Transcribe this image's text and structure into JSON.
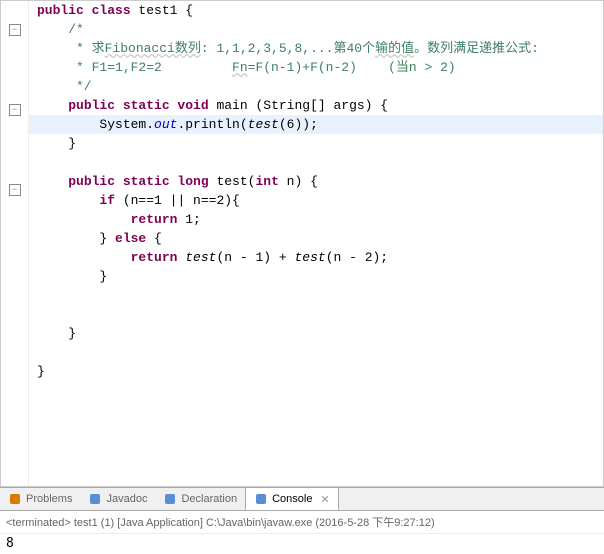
{
  "code": {
    "lines": [
      {
        "fold": null,
        "segments": [
          {
            "t": "kw",
            "v": "public class"
          },
          {
            "t": "",
            "v": " test1 {"
          }
        ]
      },
      {
        "fold": "minus",
        "segments": [
          {
            "t": "comment",
            "v": "    /*"
          }
        ]
      },
      {
        "fold": null,
        "segments": [
          {
            "t": "comment",
            "v": "     * 求"
          },
          {
            "t": "comment squiggle",
            "v": "Fibonacci数列"
          },
          {
            "t": "comment",
            "v": ": 1,1,2,3,5,8,...第40个"
          },
          {
            "t": "comment squiggle",
            "v": "输的值"
          },
          {
            "t": "comment",
            "v": "。数列满足递推公式:"
          }
        ]
      },
      {
        "fold": null,
        "segments": [
          {
            "t": "comment",
            "v": "     * F1=1,F2=2         "
          },
          {
            "t": "comment squiggle",
            "v": "Fn"
          },
          {
            "t": "comment",
            "v": "=F(n-1)+F(n-2)    (当n > 2)"
          }
        ]
      },
      {
        "fold": null,
        "segments": [
          {
            "t": "comment",
            "v": "     */"
          }
        ]
      },
      {
        "fold": "minus",
        "segments": [
          {
            "t": "",
            "v": "    "
          },
          {
            "t": "kw",
            "v": "public static void"
          },
          {
            "t": "",
            "v": " main (String[] args) {"
          }
        ]
      },
      {
        "fold": null,
        "hl": true,
        "segments": [
          {
            "t": "",
            "v": "        System."
          },
          {
            "t": "static-ref",
            "v": "out"
          },
          {
            "t": "",
            "v": ".println("
          },
          {
            "t": "method-call",
            "v": "test"
          },
          {
            "t": "",
            "v": "(6));"
          }
        ]
      },
      {
        "fold": null,
        "segments": [
          {
            "t": "",
            "v": "    }"
          }
        ]
      },
      {
        "fold": null,
        "segments": [
          {
            "t": "",
            "v": ""
          }
        ]
      },
      {
        "fold": "minus",
        "segments": [
          {
            "t": "",
            "v": "    "
          },
          {
            "t": "kw",
            "v": "public static long"
          },
          {
            "t": "",
            "v": " test("
          },
          {
            "t": "kw",
            "v": "int"
          },
          {
            "t": "",
            "v": " n) {"
          }
        ]
      },
      {
        "fold": null,
        "segments": [
          {
            "t": "",
            "v": "        "
          },
          {
            "t": "kw",
            "v": "if"
          },
          {
            "t": "",
            "v": " (n==1 || n==2){"
          }
        ]
      },
      {
        "fold": null,
        "segments": [
          {
            "t": "",
            "v": "            "
          },
          {
            "t": "kw",
            "v": "return"
          },
          {
            "t": "",
            "v": " 1;"
          }
        ]
      },
      {
        "fold": null,
        "segments": [
          {
            "t": "",
            "v": "        } "
          },
          {
            "t": "kw",
            "v": "else"
          },
          {
            "t": "",
            "v": " {"
          }
        ]
      },
      {
        "fold": null,
        "segments": [
          {
            "t": "",
            "v": "            "
          },
          {
            "t": "kw",
            "v": "return"
          },
          {
            "t": "",
            "v": " "
          },
          {
            "t": "method-call",
            "v": "test"
          },
          {
            "t": "",
            "v": "(n - 1) + "
          },
          {
            "t": "method-call",
            "v": "test"
          },
          {
            "t": "",
            "v": "(n - 2);"
          }
        ]
      },
      {
        "fold": null,
        "segments": [
          {
            "t": "",
            "v": "        }"
          }
        ]
      },
      {
        "fold": null,
        "segments": [
          {
            "t": "",
            "v": ""
          }
        ]
      },
      {
        "fold": null,
        "segments": [
          {
            "t": "",
            "v": ""
          }
        ]
      },
      {
        "fold": null,
        "segments": [
          {
            "t": "",
            "v": "    }"
          }
        ]
      },
      {
        "fold": null,
        "segments": [
          {
            "t": "",
            "v": ""
          }
        ]
      },
      {
        "fold": null,
        "segments": [
          {
            "t": "",
            "v": "}"
          }
        ]
      }
    ]
  },
  "tabs": {
    "items": [
      {
        "label": "Problems",
        "icon_color": "#d97a00"
      },
      {
        "label": "Javadoc",
        "icon_color": "#5a8fd6"
      },
      {
        "label": "Declaration",
        "icon_color": "#5a8fd6"
      },
      {
        "label": "Console",
        "icon_color": "#5a8fd6",
        "active": true
      }
    ]
  },
  "console": {
    "status": "<terminated> test1 (1) [Java Application] C:\\Java\\bin\\javaw.exe (2016-5-28 下午9:27:12)",
    "output": "8"
  }
}
